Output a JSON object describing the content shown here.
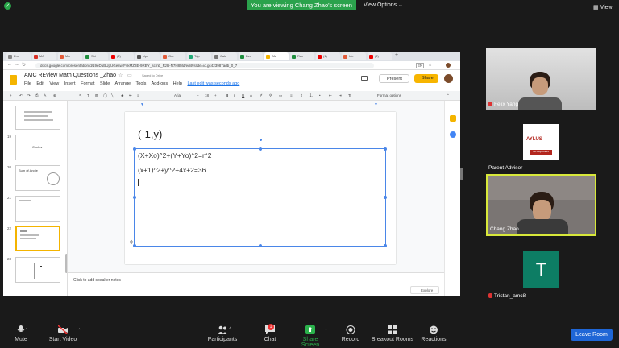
{
  "zoom": {
    "banner": "You are viewing Chang Zhao's screen",
    "view_options": "View Options ⌄",
    "view_button": "View",
    "leave": "Leave Room",
    "controls": {
      "mute": "Mute",
      "start_video": "Start Video",
      "participants": "Participants",
      "participants_count": "4",
      "chat": "Chat",
      "chat_badge": "1",
      "share_screen": "Share Screen",
      "record": "Record",
      "breakout": "Breakout Rooms",
      "reactions": "Reactions"
    },
    "participants": [
      {
        "name": "Felix Yang"
      },
      {
        "name": "Parent Advisor"
      },
      {
        "name": "Chang Zhao"
      },
      {
        "name": "Tristan_amc8"
      }
    ],
    "tristan_initial": "T",
    "aylus": {
      "logo": "AYLUS",
      "sub": "San Diego Branch"
    }
  },
  "browser": {
    "tabs": [
      "Em",
      "MA",
      "Ma",
      "Stri",
      "(2)",
      "Upc",
      "Gre",
      "Trip",
      "Calc",
      "Dec",
      "AM",
      "Rec",
      "(1)",
      "Ide",
      "(2)"
    ],
    "url": "docs.google.com/presentation/d/19eDuBUpUGeswrFskMZ8E-9RBY_scmb_RzB-N7H8Md/edit#slide=id.gc423987adb_0_7",
    "lang": "EN"
  },
  "slides": {
    "doc_title": "AMC REview Math Questions _Zhao",
    "saved": "Saved to Drive",
    "menu": [
      "File",
      "Edit",
      "View",
      "Insert",
      "Format",
      "Slide",
      "Arrange",
      "Tools",
      "Add-ons",
      "Help"
    ],
    "last_edit": "Last edit was seconds ago",
    "present": "Present",
    "share": "Share",
    "font": "Arial",
    "font_size": "18",
    "format_options": "Format options",
    "thumb_labels": {
      "t19": "Circles",
      "t20": "Sum of Angle"
    },
    "slide_numbers": [
      "19",
      "20",
      "21",
      "22",
      "23"
    ],
    "slide_title": "(-1,y)",
    "line1": "(X+Xo)^2+(Y+Yo)^2=r^2",
    "line2": "(x+1)^2+y^2+4x+2=36",
    "notes": "Click to add speaker notes",
    "explore": "Explore"
  }
}
